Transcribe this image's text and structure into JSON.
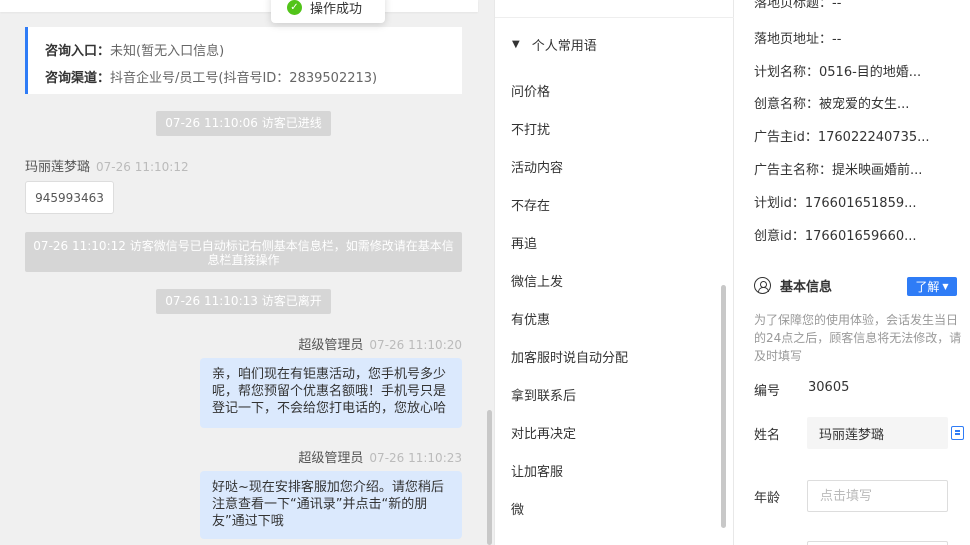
{
  "toast": {
    "text": "操作成功"
  },
  "consult": {
    "entry_key": "咨询入口：",
    "entry_value": "未知(暂无入口信息)",
    "channel_key": "咨询渠道：",
    "channel_value": "抖音企业号/员工号(抖音号ID：2839502213)"
  },
  "messages": {
    "sys_enter": "07-26 11:10:06 访客已进线",
    "visitor_name": "玛丽莲梦璐",
    "visitor_time": "07-26 11:10:12",
    "visitor_text": "945993463",
    "sys_wechat": "07-26 11:10:12 访客微信号已自动标记右侧基本信息栏，如需修改请在基本信息栏直接操作",
    "sys_leave": "07-26 11:10:13 访客已离开",
    "agent1_name": "超级管理员",
    "agent1_time": "07-26 11:10:20",
    "agent1_text": "亲，咱们现在有钜惠活动，您手机号多少呢，帮您预留个优惠名额哦！手机号只是登记一下，不会给您打电话的，您放心哈",
    "agent2_name": "超级管理员",
    "agent2_time": "07-26 11:10:23",
    "agent2_text": "好哒~现在安排客服加您介绍。请您稍后注意查看一下“通讯录”并点击“新的朋友”通过下哦"
  },
  "phrases": {
    "header": "个人常用语",
    "items": [
      "问价格",
      "不打扰",
      "活动内容",
      "不存在",
      "再追",
      "微信上发",
      "有优惠",
      "加客服时说自动分配",
      "拿到联系后",
      "对比再决定",
      "让加客服",
      "微"
    ]
  },
  "info": {
    "meta": [
      "落地页标题：--",
      "落地页地址：--",
      "计划名称：0516-目的地婚...",
      "创意名称：被宠爱的女生...",
      "广告主id：176022240735...",
      "广告主名称：提米映画婚前...",
      "计划id：176601651859...",
      "创意id：176601659660..."
    ],
    "basic_title": "基本信息",
    "learn_label": "了解",
    "notice": "为了保障您的使用体验，会话发生当日的24点之后，顾客信息将无法修改，请及时填写",
    "id_label": "编号",
    "id_value": "30605",
    "name_label": "姓名",
    "name_value": "玛丽莲梦璐",
    "age_label": "年龄",
    "age_placeholder": "点击填写"
  }
}
